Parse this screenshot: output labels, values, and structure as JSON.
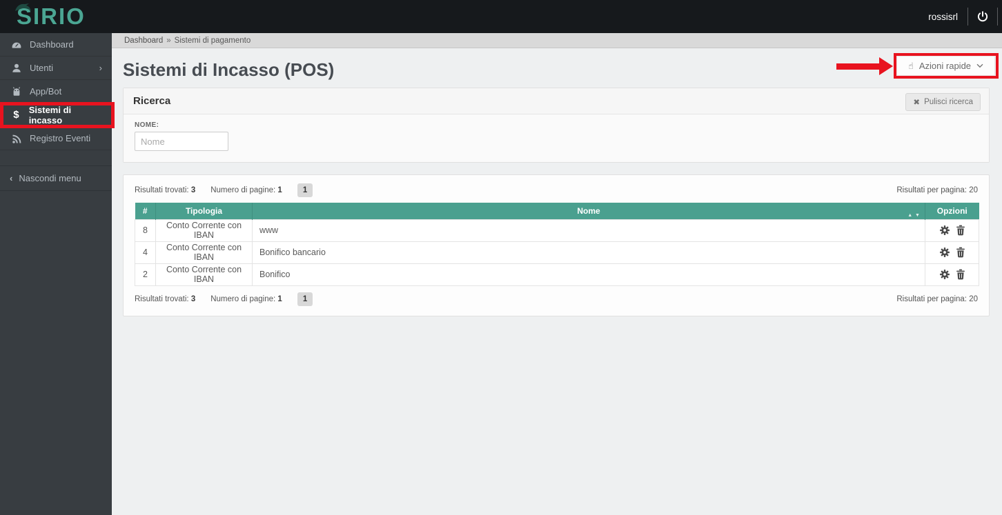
{
  "topbar": {
    "logo": "SIRIO",
    "username": "rossisrl"
  },
  "sidebar": {
    "items": [
      {
        "label": "Dashboard",
        "icon": "dashboard"
      },
      {
        "label": "Utenti",
        "icon": "user",
        "chevron": "›"
      },
      {
        "label": "App/Bot",
        "icon": "android"
      },
      {
        "label": "Sistemi di incasso",
        "icon": "dollar",
        "icon_glyph": "$",
        "active": true
      },
      {
        "label": "Registro Eventi",
        "icon": "rss"
      }
    ],
    "collapse": {
      "chevron": "‹",
      "label": "Nascondi menu"
    }
  },
  "breadcrumb": {
    "home": "Dashboard",
    "separator": "»",
    "current": "Sistemi di pagamento"
  },
  "header": {
    "title": "Sistemi di Incasso (POS)",
    "quick_actions_label": "Azioni rapide",
    "quick_actions_icon_glyph": "☝"
  },
  "search_panel": {
    "title": "Ricerca",
    "clear_icon": "✖",
    "clear_label": "Pulisci ricerca",
    "fields": [
      {
        "label": "NOME:",
        "placeholder": "Nome",
        "value": ""
      }
    ]
  },
  "results": {
    "found_label": "Risultati trovati:",
    "found_value": "3",
    "pages_label": "Numero di pagine:",
    "pages_value": "1",
    "current_page": "1",
    "per_page_label": "Risultati per pagina:",
    "per_page_value": "20"
  },
  "table": {
    "headers": [
      "#",
      "Tipologia",
      "Nome",
      "Opzioni"
    ],
    "sort_icons": "▲ ▼",
    "rows": [
      {
        "id": "8",
        "tipologia": "Conto Corrente con IBAN",
        "nome": "www"
      },
      {
        "id": "4",
        "tipologia": "Conto Corrente con IBAN",
        "nome": "Bonifico bancario"
      },
      {
        "id": "2",
        "tipologia": "Conto Corrente con IBAN",
        "nome": "Bonifico"
      }
    ]
  },
  "colors": {
    "accent_teal": "#4aa08f",
    "logo_teal": "#4ba693",
    "topbar_bg": "#16191c",
    "sidebar_bg": "#383d41",
    "annotation_red": "#e8131f"
  }
}
